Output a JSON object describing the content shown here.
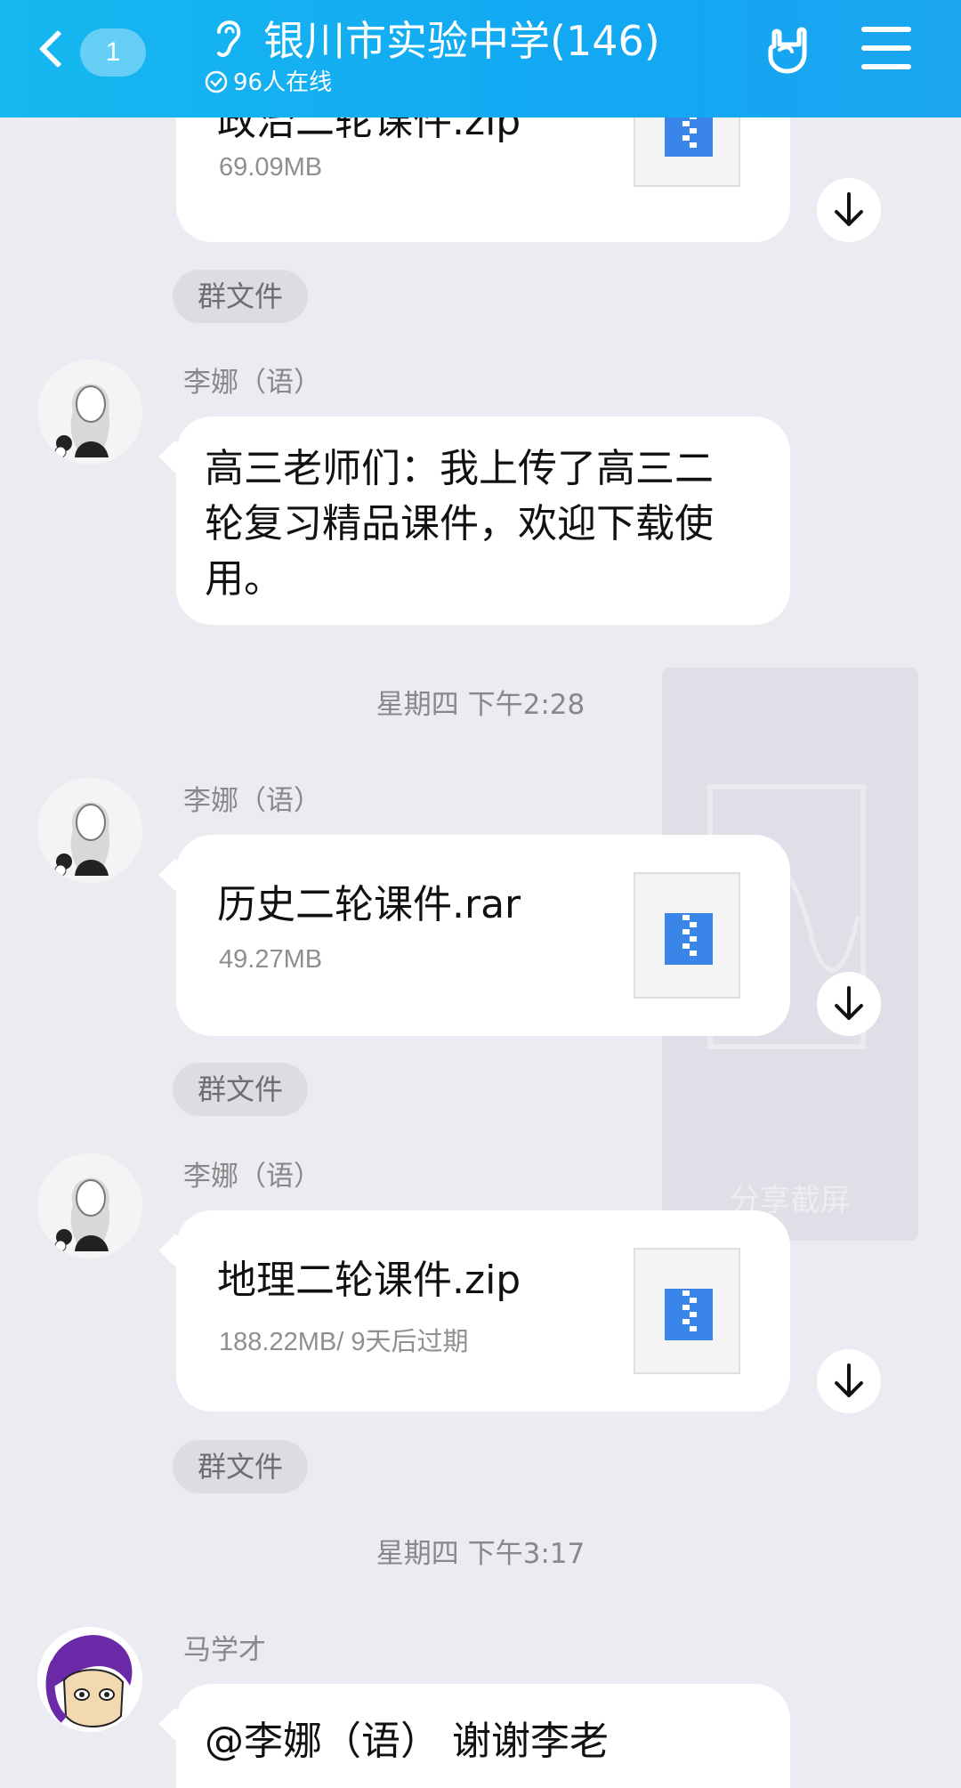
{
  "header": {
    "back_badge": "1",
    "title": "银川市实验中学(146)",
    "online": "96人在线"
  },
  "messages": [
    {
      "type": "file",
      "name": "政治二轮课件.zip",
      "meta": "69.09MB",
      "tag": "群文件"
    },
    {
      "type": "text",
      "sender": "李娜（语）",
      "text": "高三老师们：我上传了高三二轮复习精品课件，欢迎下载使用。"
    },
    {
      "type": "timestamp",
      "text": "星期四 下午2:28"
    },
    {
      "type": "file",
      "sender": "李娜（语）",
      "name": "历史二轮课件.rar",
      "meta": "49.27MB",
      "tag": "群文件"
    },
    {
      "type": "file",
      "sender": "李娜（语）",
      "name": "地理二轮课件.zip",
      "meta": "188.22MB/ 9天后过期",
      "tag": "群文件"
    },
    {
      "type": "timestamp",
      "text": "星期四 下午3:17"
    },
    {
      "type": "text",
      "sender": "马学才",
      "text": "@李娜（语） 谢谢李老"
    }
  ],
  "overlay": {
    "label": "分享截屏"
  },
  "colors": {
    "header": "#16b0f2",
    "background": "#ebecf1",
    "zip_icon": "#3a86e8"
  }
}
